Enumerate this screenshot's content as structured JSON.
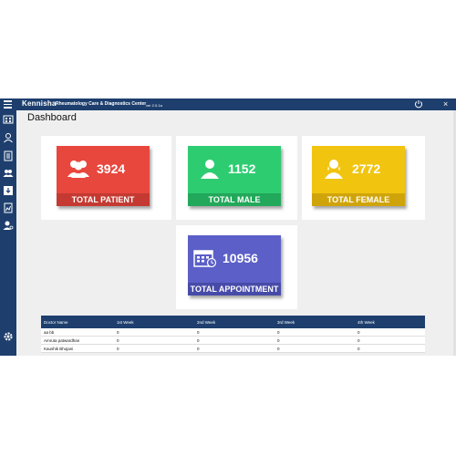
{
  "app": {
    "brand": "Kennisha",
    "subtitle": "Rheumatology Care & Diagnostics Center",
    "version": "ver 2.0.1a",
    "close_symbol": "×"
  },
  "page": {
    "title": "Dashboard"
  },
  "cards": [
    {
      "value": "3924",
      "label": "TOTAL PATIENT",
      "color": "#e8473e",
      "foot_color": "#c43a32",
      "icon": "users-icon"
    },
    {
      "value": "1152",
      "label": "TOTAL MALE",
      "color": "#2ecc71",
      "foot_color": "#22a85a",
      "icon": "male-icon"
    },
    {
      "value": "2772",
      "label": "TOTAL FEMALE",
      "color": "#f1c40f",
      "foot_color": "#cfa40b",
      "icon": "female-icon"
    },
    {
      "value": "10956",
      "label": "TOTAL APPOINTMENT",
      "color": "#5b5fc7",
      "foot_color": "#474ba8",
      "icon": "calendar-icon"
    }
  ],
  "table": {
    "headers": [
      "Doctor Name",
      "1st Week",
      "2nd Week",
      "3rd Week",
      "4th Week"
    ],
    "rows": [
      [
        "aa bb",
        "0",
        "0",
        "0",
        "0"
      ],
      [
        "Amruta patwardhan",
        "0",
        "0",
        "0",
        "0"
      ],
      [
        "Kaushik Bhojani",
        "0",
        "0",
        "0",
        "0"
      ]
    ]
  },
  "colors": {
    "nav": "#1e3f6e",
    "background": "#efefef"
  }
}
